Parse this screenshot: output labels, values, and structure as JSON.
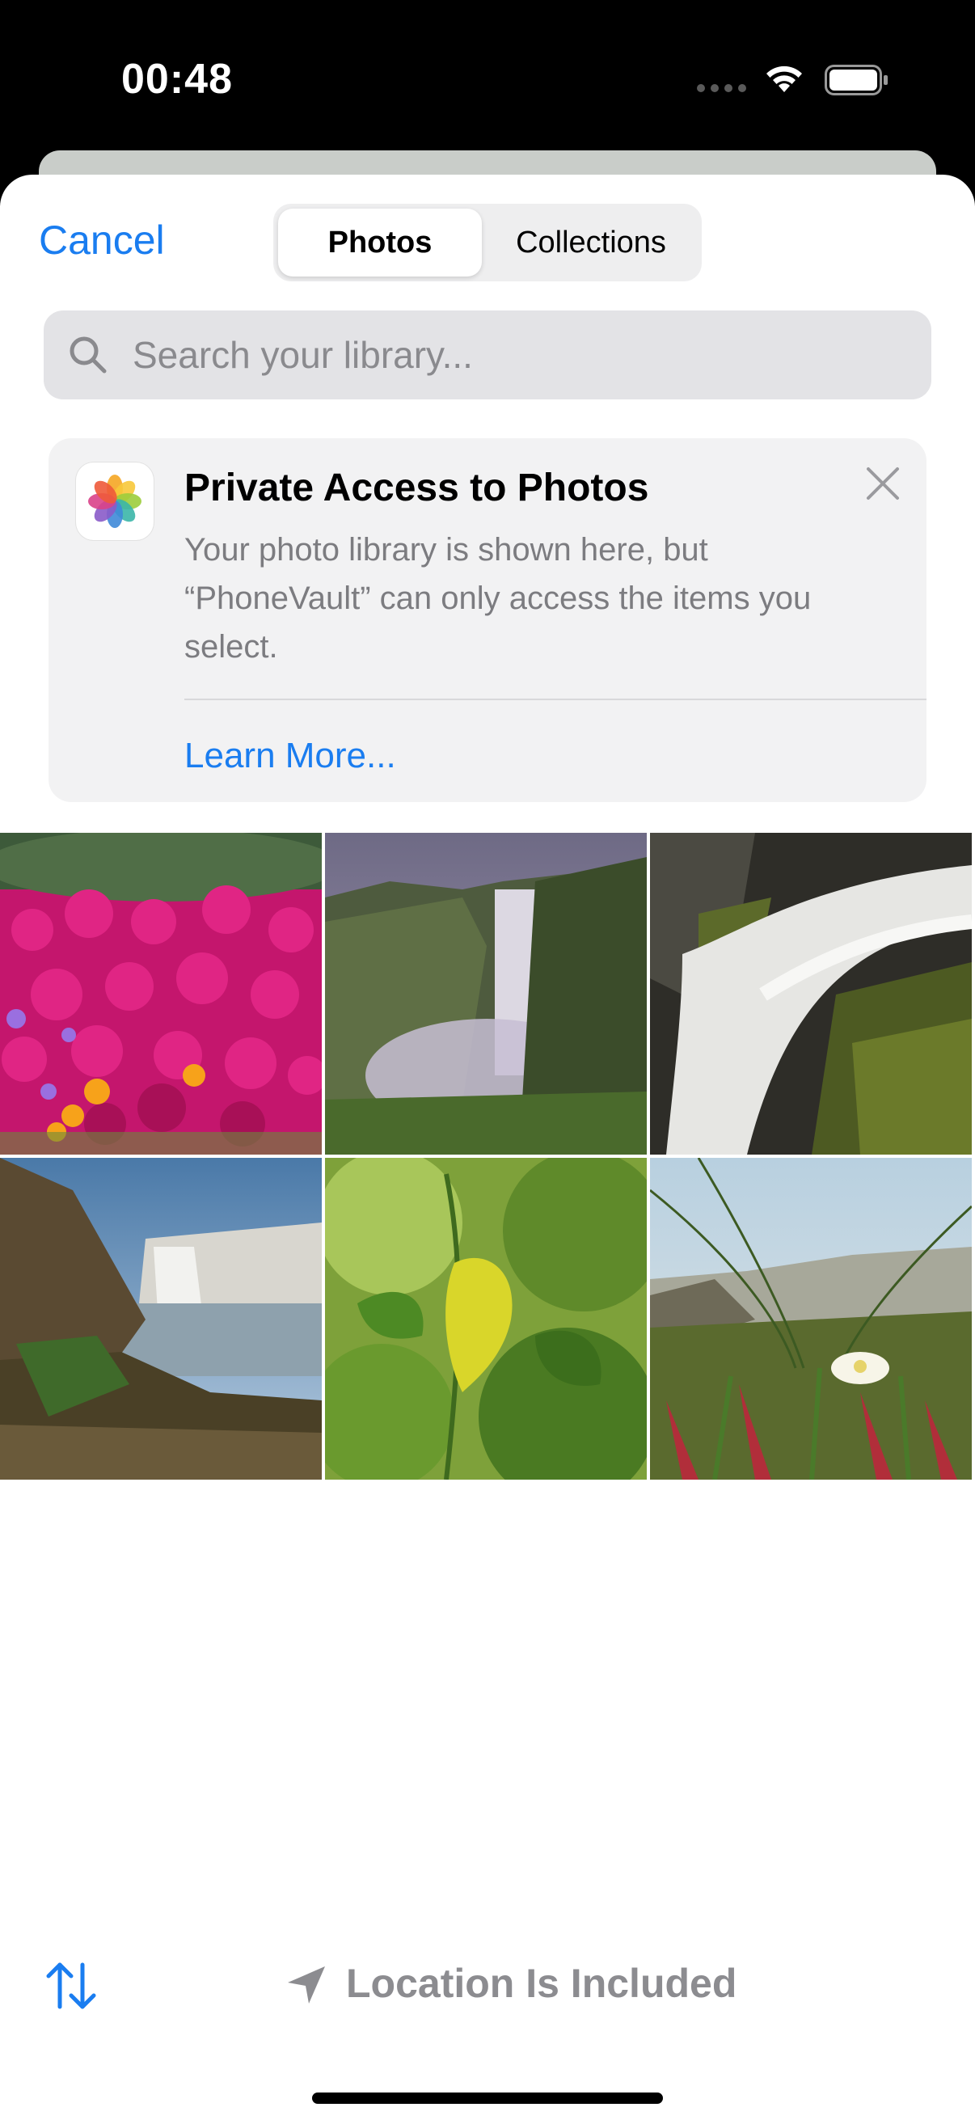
{
  "status_bar": {
    "time": "00:48",
    "icons": [
      "cellular-dots-icon",
      "wifi-icon",
      "battery-icon"
    ]
  },
  "header": {
    "cancel_label": "Cancel",
    "tabs": [
      {
        "label": "Photos",
        "selected": true
      },
      {
        "label": "Collections",
        "selected": false
      }
    ]
  },
  "search": {
    "placeholder": "Search your library..."
  },
  "banner": {
    "title": "Private Access to Photos",
    "body": "Your photo library is shown here, but “PhoneVault” can only access the items you select.",
    "link": "Learn More..."
  },
  "photos": [
    {
      "subject": "magenta ice plant flowers"
    },
    {
      "subject": "waterfall in misty gorge"
    },
    {
      "subject": "long exposure waterfall over mossy rocks"
    },
    {
      "subject": "waterfall with rocky shore"
    },
    {
      "subject": "yellow leaf on green plant"
    },
    {
      "subject": "beach grass with white flower"
    }
  ],
  "footer": {
    "location_label": "Location Is Included",
    "icons": [
      "sort-arrows-icon",
      "location-arrow-icon"
    ]
  },
  "colors": {
    "accent": "#1a7df0",
    "sheet_background": "#ffffff",
    "banner_background": "#f2f2f3",
    "search_background": "#e3e3e6"
  }
}
